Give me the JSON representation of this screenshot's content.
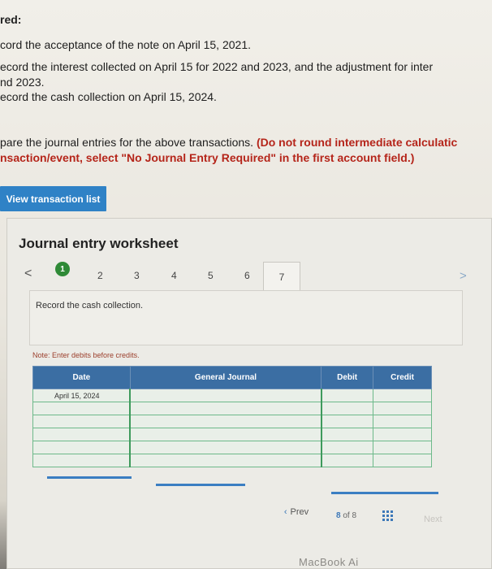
{
  "heading": "red:",
  "requirements": [
    "cord the acceptance of the note on April 15, 2021.",
    "ecord the interest collected on April 15 for 2022 and 2023, and the adjustment for inter",
    "nd 2023.",
    "ecord the cash collection on April 15, 2024."
  ],
  "instructions": {
    "line1_plain": "pare the journal entries for the above transactions.",
    "line1_red": "(Do not round intermediate calculatic",
    "line2_red": "nsaction/event, select \"No Journal Entry Required\" in the first account field.)"
  },
  "view_button": "View transaction list",
  "worksheet": {
    "title": "Journal entry worksheet",
    "prev_arrow": "<",
    "next_arrow": ">",
    "steps": [
      "1",
      "2",
      "3",
      "4",
      "5",
      "6",
      "7"
    ],
    "record_text": "Record the cash collection.",
    "note": "Note: Enter debits before credits."
  },
  "table": {
    "headers": [
      "Date",
      "General Journal",
      "Debit",
      "Credit"
    ],
    "rows": [
      [
        "April 15, 2024",
        "",
        "",
        ""
      ],
      [
        "",
        "",
        "",
        ""
      ],
      [
        "",
        "",
        "",
        ""
      ],
      [
        "",
        "",
        "",
        ""
      ],
      [
        "",
        "",
        "",
        ""
      ],
      [
        "",
        "",
        "",
        ""
      ]
    ]
  },
  "pagination": {
    "prev_label": "Prev",
    "current": "8",
    "of_label": "of",
    "total": "8",
    "next_label": "Next"
  },
  "bezel_text": "MacBook Ai",
  "colors": {
    "accent_blue": "#2f82c6",
    "table_header": "#3b6ea3",
    "active_step": "#2f8a37",
    "instruction_red": "#b5251a"
  }
}
